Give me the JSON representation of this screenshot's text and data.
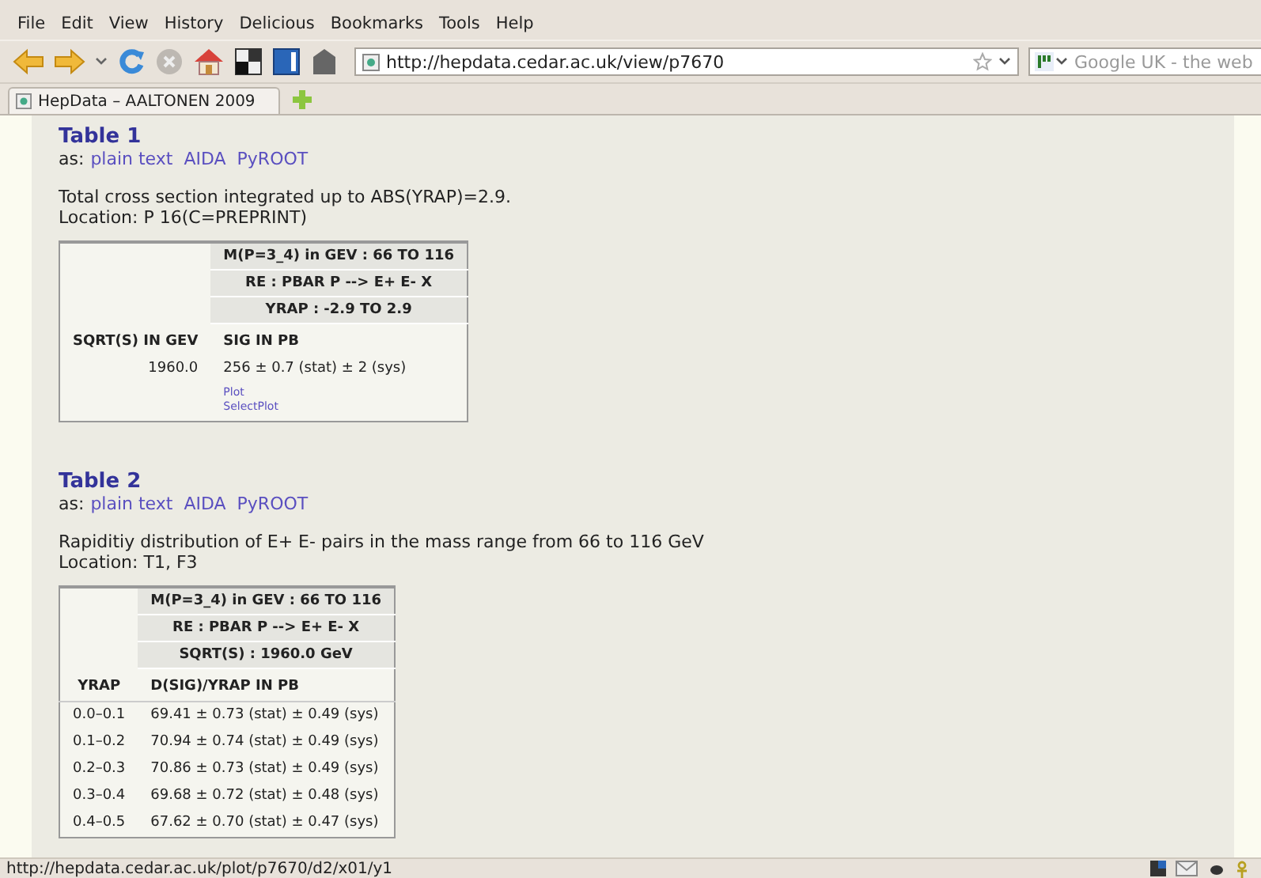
{
  "menu": [
    "File",
    "Edit",
    "View",
    "History",
    "Delicious",
    "Bookmarks",
    "Tools",
    "Help"
  ],
  "address": {
    "value": "http://hepdata.cedar.ac.uk/view/p7670"
  },
  "search": {
    "placeholder": "Google UK - the web"
  },
  "tabs": [
    {
      "label": "HepData – AALTONEN 2009",
      "selected": true
    }
  ],
  "tables": [
    {
      "title": "Table 1",
      "formats_label": "as:",
      "formats": [
        "plain text",
        "AIDA",
        "PyROOT"
      ],
      "description": "Total cross section integrated up to ABS(YRAP)=2.9.",
      "location": "Location: P 16(C=PREPRINT)",
      "qualifiers": [
        "M(P=3_4) in GEV : 66 TO 116",
        "RE : PBAR P --> E+ E- X",
        "YRAP : -2.9 TO 2.9"
      ],
      "x_header": "SQRT(S) IN GEV",
      "y_header": "SIG IN PB",
      "rows": [
        [
          "1960.0",
          "256 ± 0.7 (stat) ± 2 (sys)"
        ]
      ],
      "plot_links": [
        "Plot",
        "SelectPlot"
      ]
    },
    {
      "title": "Table 2",
      "formats_label": "as:",
      "formats": [
        "plain text",
        "AIDA",
        "PyROOT"
      ],
      "description": "Rapiditiy distribution of E+ E- pairs in the mass range from 66 to 116 GeV",
      "location": "Location: T1, F3",
      "qualifiers": [
        "M(P=3_4) in GEV : 66 TO 116",
        "RE : PBAR P --> E+ E- X",
        "SQRT(S) : 1960.0 GeV"
      ],
      "x_header": "YRAP",
      "y_header": "D(SIG)/YRAP IN PB",
      "rows": [
        [
          "0.0–0.1",
          "69.41 ± 0.73 (stat) ± 0.49 (sys)"
        ],
        [
          "0.1–0.2",
          "70.94 ± 0.74 (stat) ± 0.49 (sys)"
        ],
        [
          "0.2–0.3",
          "70.86 ± 0.73 (stat) ± 0.49 (sys)"
        ],
        [
          "0.3–0.4",
          "69.68 ± 0.72 (stat) ± 0.48 (sys)"
        ],
        [
          "0.4–0.5",
          "67.62 ± 0.70 (stat) ± 0.47 (sys)"
        ]
      ]
    }
  ],
  "status_bar": {
    "text": "http://hepdata.cedar.ac.uk/plot/p7670/d2/x01/y1"
  }
}
